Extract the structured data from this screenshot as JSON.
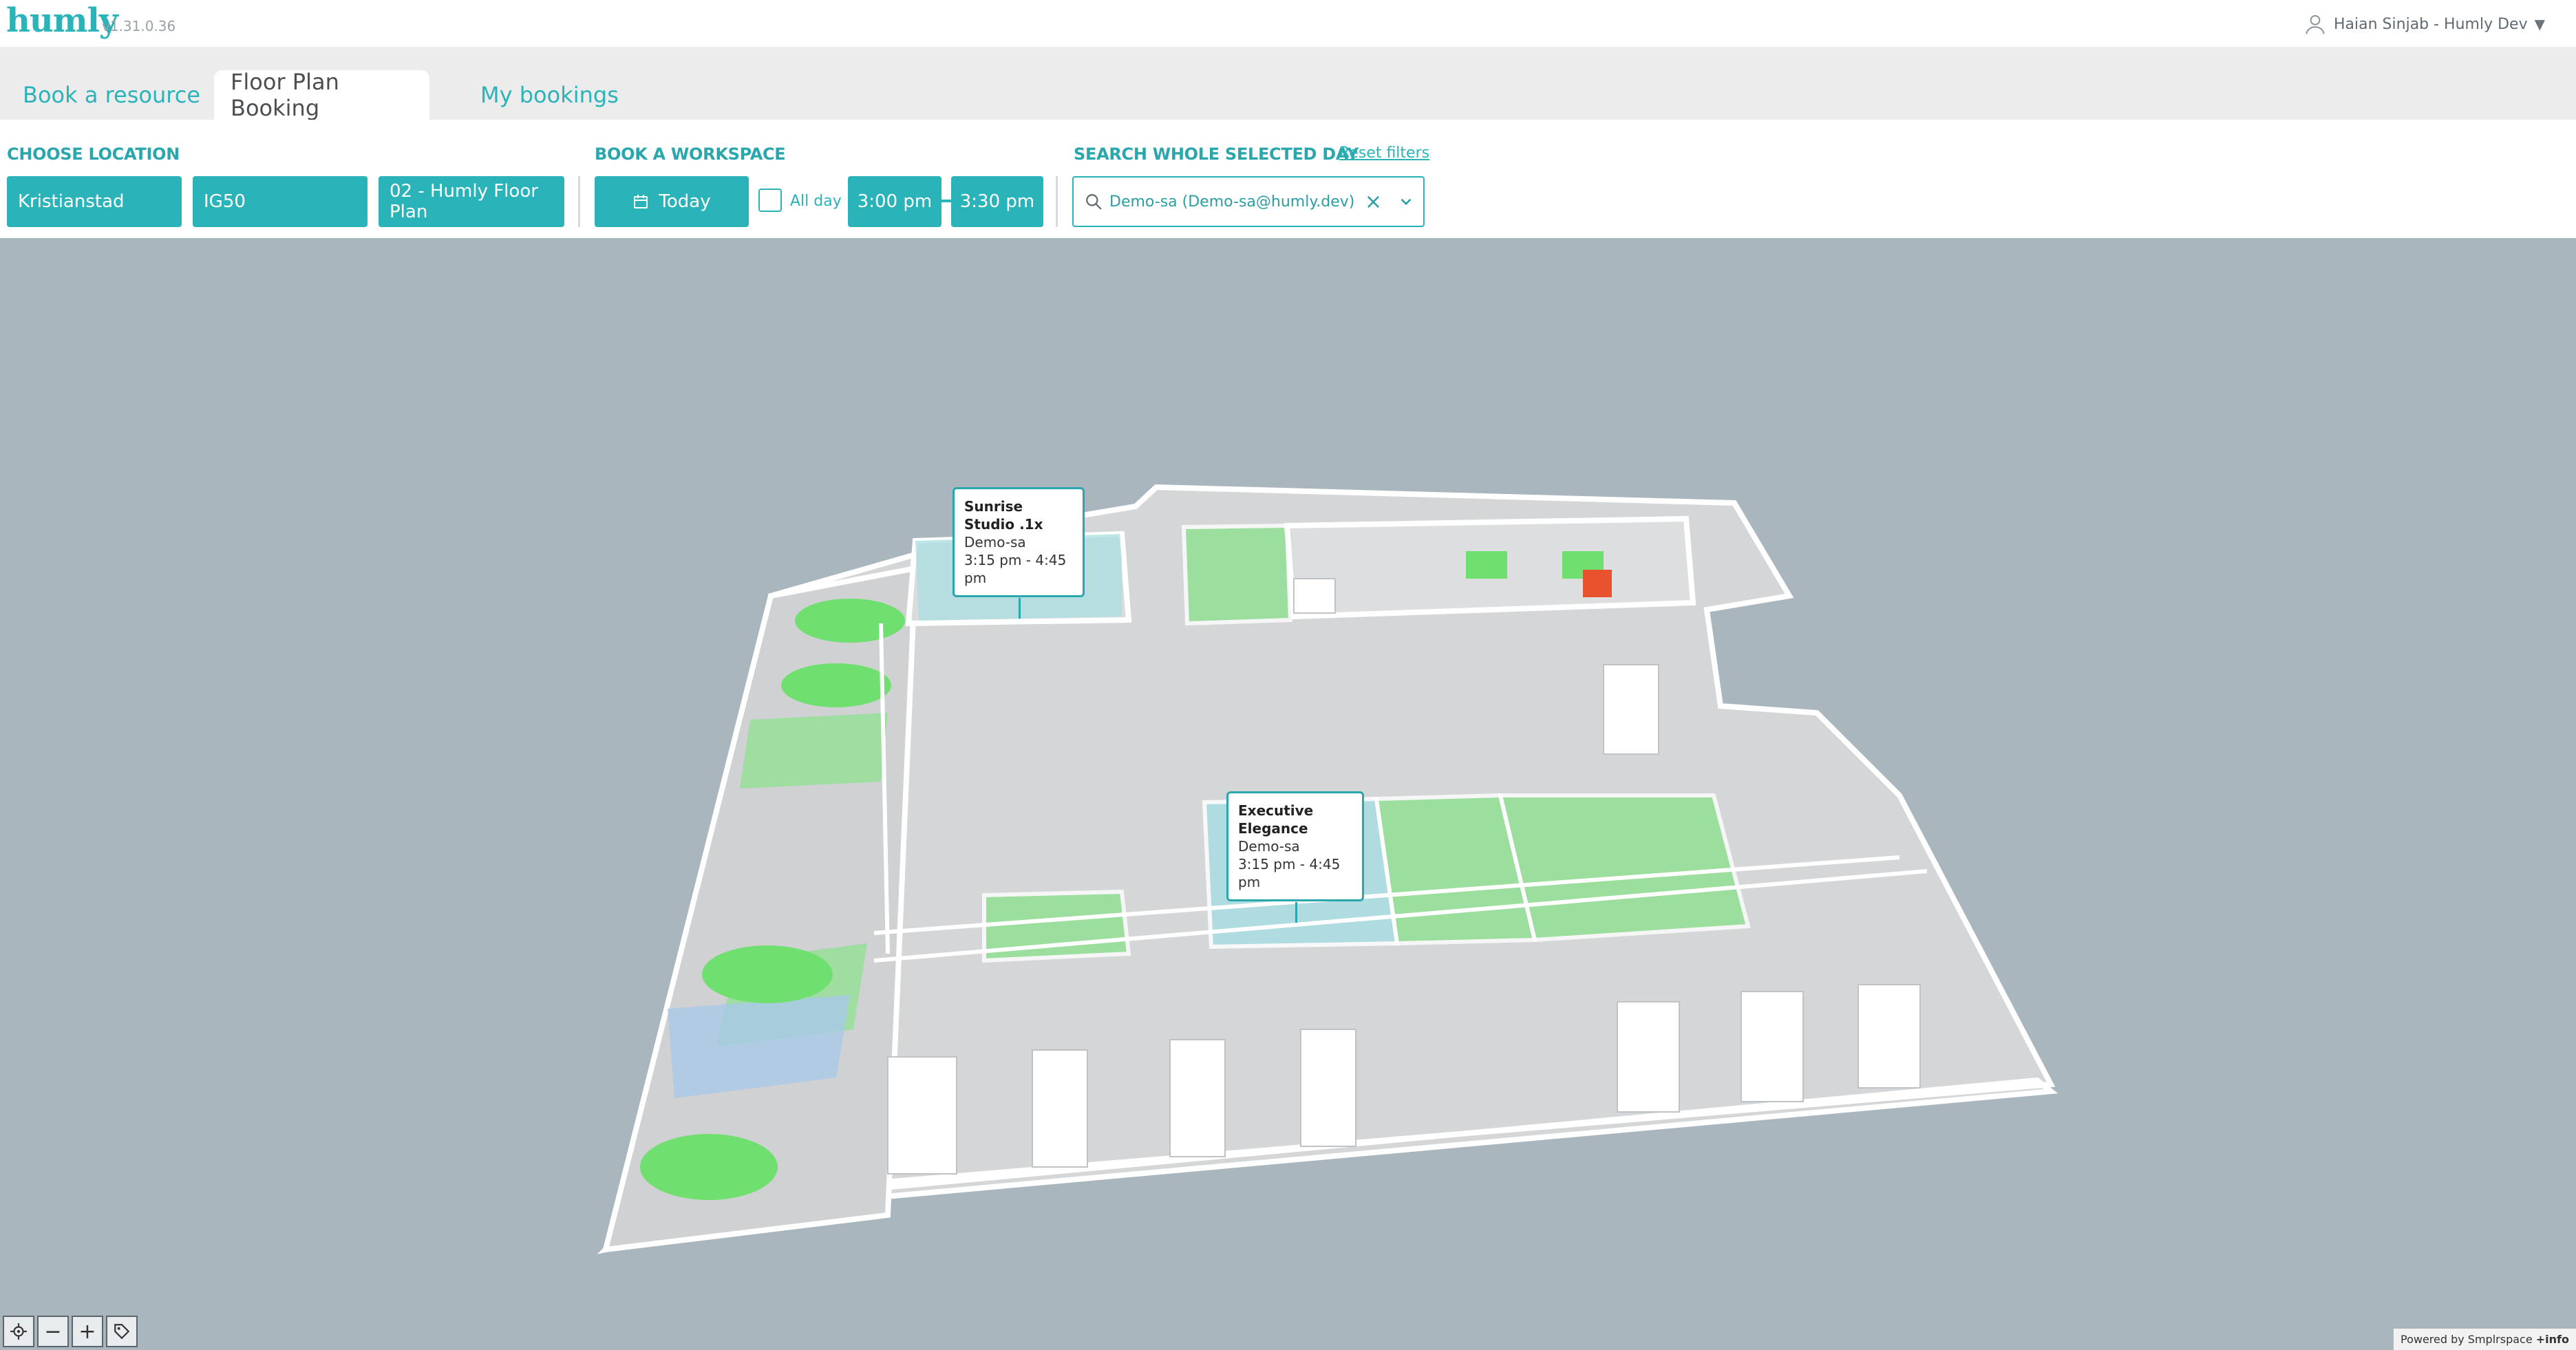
{
  "app": {
    "logo": "humly",
    "version": "v1.31.0.36",
    "user": "Haian Sinjab - Humly Dev"
  },
  "tabs": [
    {
      "label": "Book a resource",
      "active": false
    },
    {
      "label": "Floor Plan Booking",
      "active": true
    },
    {
      "label": "My bookings",
      "active": false
    }
  ],
  "filters": {
    "choose_location_label": "CHOOSE LOCATION",
    "location_city": "Kristianstad",
    "location_building": "IG50",
    "location_floor": "02 - Humly Floor Plan",
    "book_workspace_label": "BOOK A WORKSPACE",
    "date": "Today",
    "all_day_label": "All day",
    "all_day_checked": false,
    "start_time": "3:00 pm",
    "end_time": "3:30 pm",
    "search_day_label": "SEARCH WHOLE SELECTED DAY",
    "reset_filters": "Reset filters",
    "search_value": "Demo-sa (Demo-sa@humly.dev)"
  },
  "map": {
    "tooltips": [
      {
        "title": "Sunrise Studio .1x",
        "organizer": "Demo-sa",
        "time": "3:15 pm - 4:45 pm"
      },
      {
        "title": "Executive Elegance",
        "organizer": "Demo-sa",
        "time": "3:15 pm - 4:45 pm"
      }
    ],
    "colors": {
      "available": "#6fe06f",
      "booked": "#9fdde0",
      "occupied": "#e8532e",
      "background": "#aab6bd"
    },
    "controls": [
      "locate-icon",
      "zoom-out-icon",
      "zoom-in-icon",
      "tag-icon"
    ],
    "powered_by": "Powered by Smplrspace",
    "info_label": "+info"
  }
}
